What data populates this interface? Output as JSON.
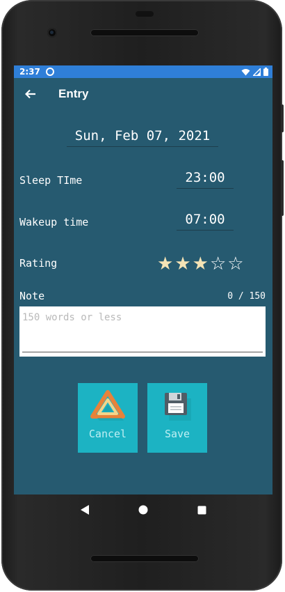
{
  "status_bar": {
    "time": "2:37"
  },
  "app_bar": {
    "title": "Entry"
  },
  "entry": {
    "date": "Sun, Feb 07, 2021",
    "sleep_label": "Sleep TIme",
    "sleep_value": "23:00",
    "wakeup_label": "Wakeup time",
    "wakeup_value": "07:00",
    "rating_label": "Rating",
    "rating": 3,
    "rating_max": 5,
    "note_label": "Note",
    "note_counter": "0 / 150",
    "note_value": "",
    "note_placeholder": "150 words or less"
  },
  "actions": {
    "cancel_label": "Cancel",
    "save_label": "Save"
  },
  "colors": {
    "screen_bg": "#265a70",
    "status_bar": "#2f7fd8",
    "button_bg": "#1cb3c3",
    "star_filled": "#f4e3b5"
  },
  "icons": {
    "back": "arrow-left-icon",
    "cancel": "warning-triangle-icon",
    "save": "floppy-disk-icon"
  }
}
